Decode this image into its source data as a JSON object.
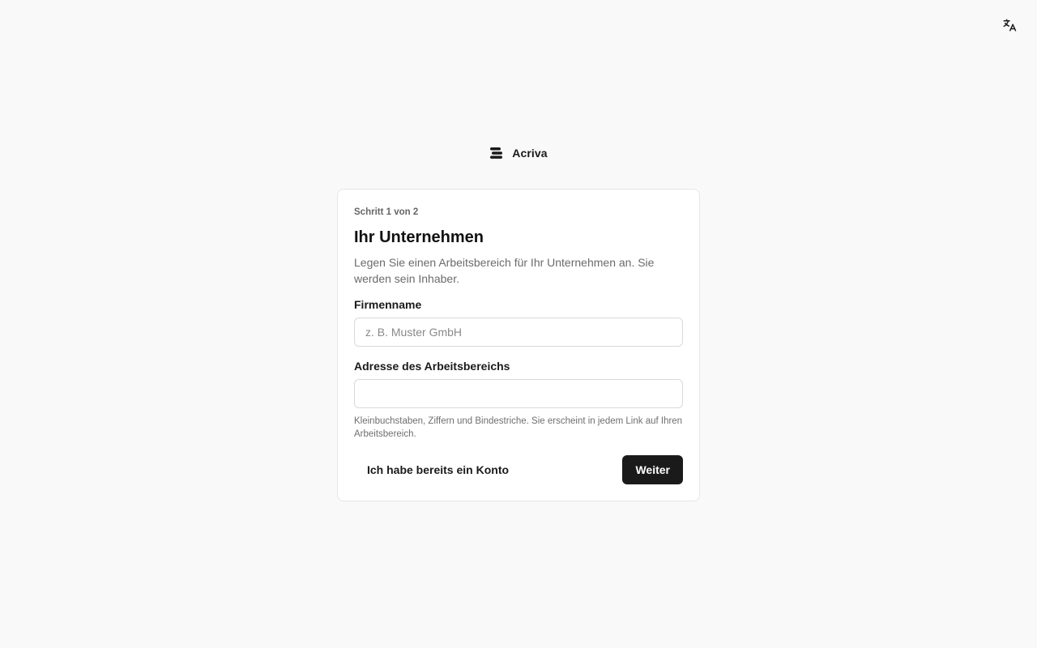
{
  "header": {
    "language_icon": "translate-icon"
  },
  "brand": {
    "logo_icon": "stack-logo-icon",
    "name": "Acriva"
  },
  "card": {
    "step": "Schritt 1 von 2",
    "title": "Ihr Unternehmen",
    "description": "Legen Sie einen Arbeitsbereich für Ihr Unternehmen an. Sie werden sein Inhaber.",
    "company_field": {
      "label": "Firmenname",
      "value": "",
      "placeholder": "z. B. Muster GmbH"
    },
    "workspace_field": {
      "label": "Adresse des Arbeitsbereichs",
      "value": "",
      "placeholder": "",
      "hint": "Kleinbuchstaben, Ziffern und Bindestriche. Sie erscheint in jedem Link auf Ihren Arbeitsbereich."
    },
    "actions": {
      "have_account_label": "Ich habe bereits ein Konto",
      "next_label": "Weiter"
    }
  },
  "colors": {
    "background": "#f9f9f9",
    "card": "#ffffff",
    "primary": "#1a1a1a",
    "border": "#d9d9d9"
  }
}
